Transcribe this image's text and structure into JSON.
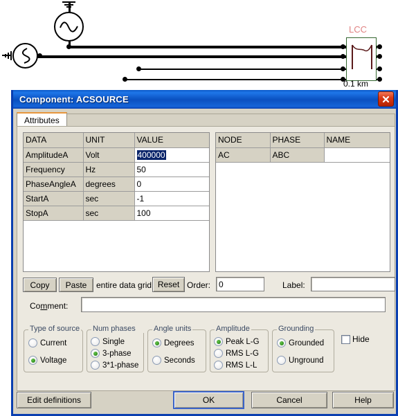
{
  "background": {
    "component_label": "LCC",
    "line_length_label": "0.1 km"
  },
  "dialog": {
    "title": "Component: ACSOURCE",
    "close_icon": "close-icon",
    "tabs": [
      {
        "label": "Attributes",
        "active": true
      }
    ],
    "data_grid": {
      "columns": [
        "DATA",
        "UNIT",
        "VALUE"
      ],
      "rows": [
        {
          "data": "AmplitudeA",
          "unit": "Volt",
          "value": "400000",
          "selected": true
        },
        {
          "data": "Frequency",
          "unit": "Hz",
          "value": "50",
          "selected": false
        },
        {
          "data": "PhaseAngleA",
          "unit": "degrees",
          "value": "0",
          "selected": false
        },
        {
          "data": "StartA",
          "unit": "sec",
          "value": "-1",
          "selected": false
        },
        {
          "data": "StopA",
          "unit": "sec",
          "value": "100",
          "selected": false
        }
      ]
    },
    "node_grid": {
      "columns": [
        "NODE",
        "PHASE",
        "NAME"
      ],
      "rows": [
        {
          "node": "AC",
          "phase": "ABC",
          "name": ""
        }
      ]
    },
    "grid_actions": {
      "copy_label": "Copy",
      "paste_label": "Paste",
      "grid_scope_label": "entire data grid",
      "reset_label": "Reset"
    },
    "order": {
      "label": "Order:",
      "value": "0"
    },
    "label_field": {
      "label": "Label:",
      "value": ""
    },
    "comment_field": {
      "label": "Comment:",
      "value": ""
    },
    "groups": {
      "type_of_source": {
        "title": "Type of source",
        "options": [
          {
            "label": "Current",
            "selected": false
          },
          {
            "label": "Voltage",
            "selected": true
          }
        ]
      },
      "num_phases": {
        "title": "Num phases",
        "options": [
          {
            "label": "Single",
            "selected": false
          },
          {
            "label": "3-phase",
            "selected": true
          },
          {
            "label": "3*1-phase",
            "selected": false
          }
        ]
      },
      "angle_units": {
        "title": "Angle units",
        "options": [
          {
            "label": "Degrees",
            "selected": true
          },
          {
            "label": "Seconds",
            "selected": false
          }
        ]
      },
      "amplitude": {
        "title": "Amplitude",
        "options": [
          {
            "label": "Peak L-G",
            "selected": true
          },
          {
            "label": "RMS L-G",
            "selected": false
          },
          {
            "label": "RMS L-L",
            "selected": false
          }
        ]
      },
      "grounding": {
        "title": "Grounding",
        "options": [
          {
            "label": "Grounded",
            "selected": true
          },
          {
            "label": "Unground",
            "selected": false
          }
        ]
      }
    },
    "hide_checkbox": {
      "label": "Hide",
      "checked": false
    },
    "footer": {
      "edit_definitions_label": "Edit definitions",
      "ok_label": "OK",
      "cancel_label": "Cancel",
      "help_label": "Help"
    }
  },
  "colors": {
    "titlebar_blue": "#0a50c0",
    "dialog_face": "#d6d2c4",
    "tab_page": "#ece9e0",
    "selection_blue": "#0a246a",
    "lcc_red": "#e08282",
    "lcc_border_green": "#33662f",
    "radio_green": "#2f8f1f",
    "tab_accent_orange": "#e8963c"
  }
}
